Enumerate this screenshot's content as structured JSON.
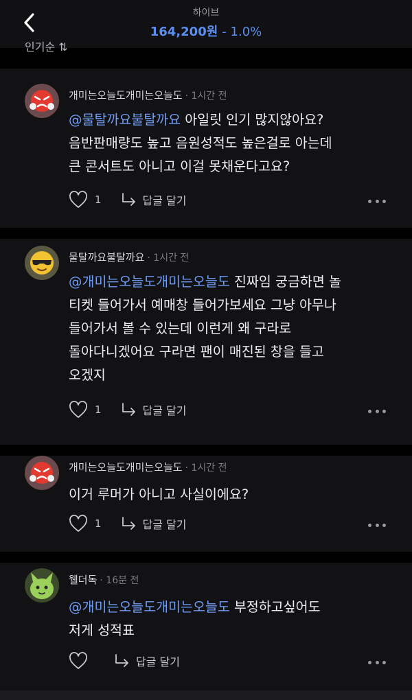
{
  "header": {
    "title": "하이브",
    "price": "164,200원",
    "change": "- 1.0%"
  },
  "sort_label": "인기순 ⇅",
  "comments": [
    {
      "author": "개미는오늘도개미는오늘도",
      "time": "· 1시간 전",
      "mention": "@물탈까요불탈까요",
      "text_line1_rest": " 아일릿 인기 많지않아요?",
      "text_line2": "음반판매량도 높고 음원성적도 높은걸로 아는데",
      "text_line3": "큰 콘서트도 아니고 이걸 못채운다고요?",
      "likes": "1",
      "reply_label": "답글 달기"
    },
    {
      "author": "물탈까요불탈까요",
      "time": "· 1시간 전",
      "mention": "@개미는오늘도개미는오늘도",
      "text_line1_rest": " 진짜임 궁금하면 놀",
      "text_line2": "티켓 들어가서 예매창 들어가보세요 그냥 아무나",
      "text_line3": "들어가서 볼 수 있는데 이런게 왜 구라로",
      "text_line4": "돌아다니겠어요 구라면 팬이 매진된 창을 들고",
      "text_line5": "오겠지",
      "likes": "1",
      "reply_label": "답글 달기"
    },
    {
      "author": "개미는오늘도개미는오늘도",
      "time": "· 1시간 전",
      "text_line1": "이거 루머가 아니고 사실이에요?",
      "likes": "1",
      "reply_label": "답글 달기"
    },
    {
      "author": "웰더독",
      "time": "· 16분 전",
      "mention": "@개미는오늘도개미는오늘도",
      "text_line1_rest": " 부정하고싶어도",
      "text_line2": "저게 성적표",
      "likes": "",
      "reply_label": "답글 달기"
    }
  ],
  "colors": {
    "accent_blue": "#5a8ef0",
    "mention_blue": "#6f9cf5",
    "card_bg": "#121215",
    "page_bg": "#000000"
  },
  "icons": [
    "back-chevron-icon",
    "heart-icon",
    "reply-arrow-icon",
    "more-dots-icon"
  ]
}
